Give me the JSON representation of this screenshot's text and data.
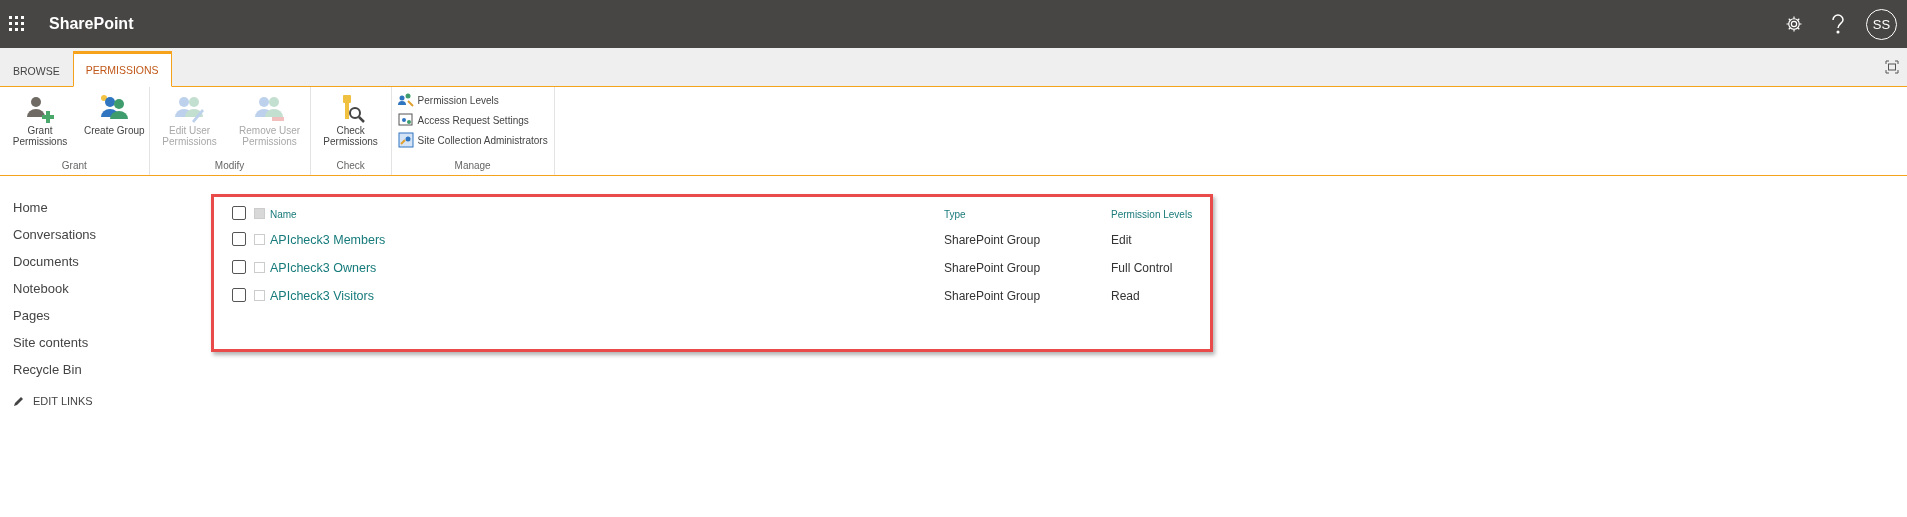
{
  "suite_bar": {
    "title": "SharePoint",
    "avatar": "SS"
  },
  "ribbon_tabs": [
    {
      "label": "BROWSE",
      "selected": false
    },
    {
      "label": "PERMISSIONS",
      "selected": true
    }
  ],
  "ribbon_groups": [
    {
      "label": "Grant",
      "kind": "large",
      "buttons": [
        {
          "label": "Grant Permissions",
          "disabled": false
        },
        {
          "label": "Create Group",
          "disabled": false
        }
      ]
    },
    {
      "label": "Modify",
      "kind": "large",
      "buttons": [
        {
          "label": "Edit User Permissions",
          "disabled": true
        },
        {
          "label": "Remove User Permissions",
          "disabled": true
        }
      ]
    },
    {
      "label": "Check",
      "kind": "large",
      "buttons": [
        {
          "label": "Check Permissions",
          "disabled": false
        }
      ]
    },
    {
      "label": "Manage",
      "kind": "small",
      "buttons": [
        {
          "label": "Permission Levels",
          "disabled": false
        },
        {
          "label": "Access Request Settings",
          "disabled": false
        },
        {
          "label": "Site Collection Administrators",
          "disabled": false
        }
      ]
    }
  ],
  "quick_launch": {
    "items": [
      "Home",
      "Conversations",
      "Documents",
      "Notebook",
      "Pages",
      "Site contents",
      "Recycle Bin"
    ],
    "edit_links": "EDIT LINKS"
  },
  "table": {
    "columns": [
      "Name",
      "Type",
      "Permission Levels"
    ],
    "select_all_checked": false,
    "select_all_items_checked": true,
    "rows": [
      {
        "name": "APIcheck3 Members",
        "type": "SharePoint Group",
        "permission": "Edit",
        "checked": false,
        "item_checked": false
      },
      {
        "name": "APIcheck3 Owners",
        "type": "SharePoint Group",
        "permission": "Full Control",
        "checked": false,
        "item_checked": false
      },
      {
        "name": "APIcheck3 Visitors",
        "type": "SharePoint Group",
        "permission": "Read",
        "checked": false,
        "item_checked": false
      }
    ]
  }
}
